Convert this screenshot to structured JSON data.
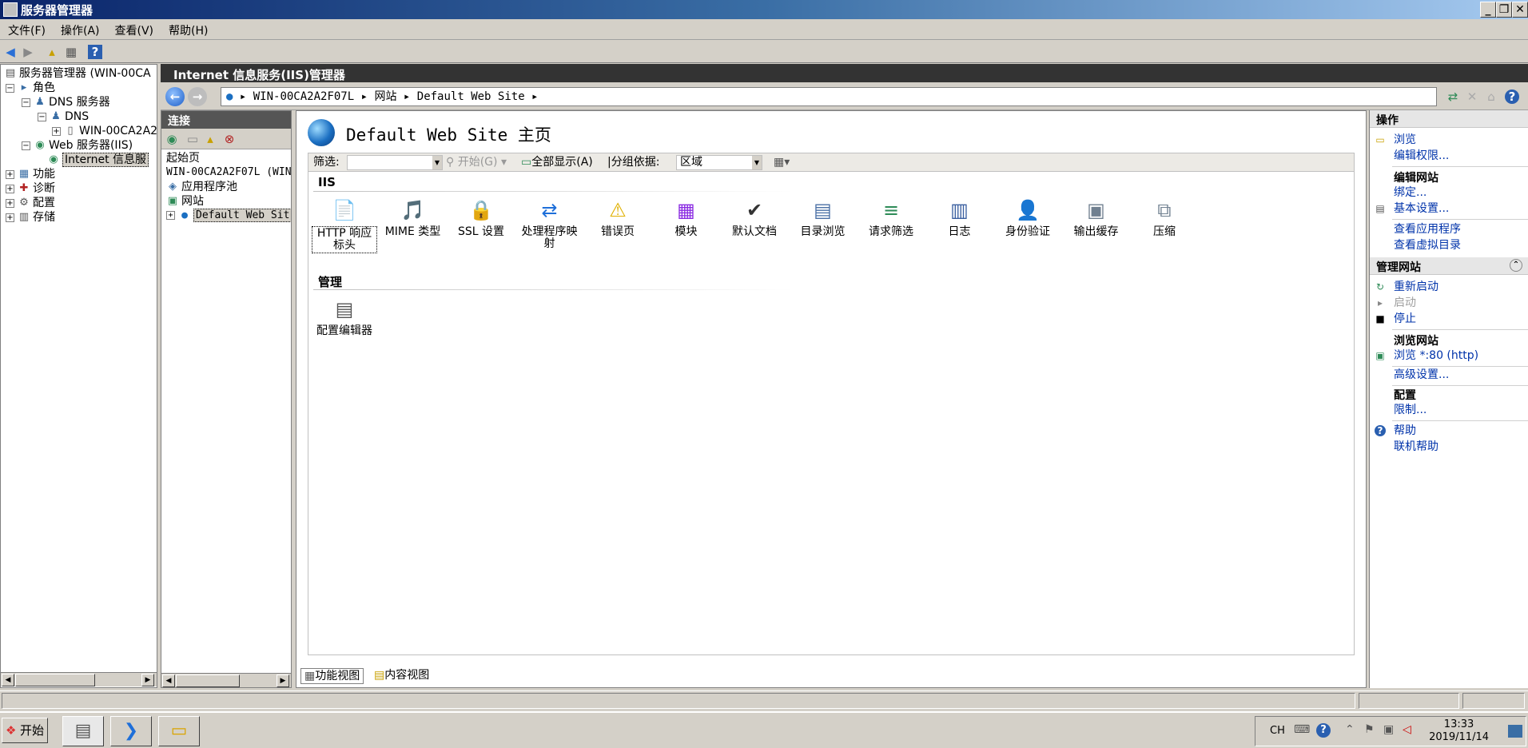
{
  "window": {
    "title": "服务器管理器",
    "min_symbol": "_",
    "restore_symbol": "❐",
    "close_symbol": "✕"
  },
  "menu": [
    "文件(F)",
    "操作(A)",
    "查看(V)",
    "帮助(H)"
  ],
  "tree": {
    "root": "服务器管理器 (WIN-00CA",
    "roles": "角色",
    "dns_server": "DNS 服务器",
    "dns": "DNS",
    "dns_host": "WIN-00CA2A2F",
    "web_server": "Web 服务器(IIS)",
    "iis": "Internet 信息服",
    "features": "功能",
    "diagnostics": "诊断",
    "config": "配置",
    "storage": "存储"
  },
  "iis_header": "Internet 信息服务(IIS)管理器",
  "breadcrumb": [
    "WIN-00CA2A2F07L",
    "网站",
    "Default Web Site"
  ],
  "connections": {
    "title": "连接",
    "start_page": "起始页",
    "server": "WIN-00CA2A2F07L (WIN",
    "app_pools": "应用程序池",
    "sites": "网站",
    "default_site": "Default Web Sit"
  },
  "main": {
    "title": "Default Web Site 主页",
    "filter_label": "筛选:",
    "go_label": "开始(G)",
    "show_all_label": "全部显示(A)",
    "group_by_label": "分组依据:",
    "group_by_value": "区域",
    "section_iis": "IIS",
    "section_manage": "管理",
    "features_iis": [
      {
        "name": "http-response-headers",
        "label": "HTTP 响应标头",
        "icon": "📄",
        "color": "#2e8b57"
      },
      {
        "name": "mime-types",
        "label": "MIME 类型",
        "icon": "🎵",
        "color": "#6a5acd"
      },
      {
        "name": "ssl-settings",
        "label": "SSL 设置",
        "icon": "🔒",
        "color": "#d4a017"
      },
      {
        "name": "handler-mappings",
        "label": "处理程序映射",
        "icon": "⇄",
        "color": "#1e6fd9"
      },
      {
        "name": "error-pages",
        "label": "错误页",
        "icon": "⚠",
        "color": "#e0b000"
      },
      {
        "name": "modules",
        "label": "模块",
        "icon": "▦",
        "color": "#8a2be2"
      },
      {
        "name": "default-document",
        "label": "默认文档",
        "icon": "✔",
        "color": "#333333"
      },
      {
        "name": "directory-browsing",
        "label": "目录浏览",
        "icon": "▤",
        "color": "#4a6fa5"
      },
      {
        "name": "request-filtering",
        "label": "请求筛选",
        "icon": "≡",
        "color": "#2e8b57"
      },
      {
        "name": "logging",
        "label": "日志",
        "icon": "▥",
        "color": "#3a5fa0"
      },
      {
        "name": "authentication",
        "label": "身份验证",
        "icon": "👤",
        "color": "#b8860b"
      },
      {
        "name": "output-caching",
        "label": "输出缓存",
        "icon": "▣",
        "color": "#708090"
      },
      {
        "name": "compression",
        "label": "压缩",
        "icon": "⧉",
        "color": "#708090"
      }
    ],
    "features_manage": [
      {
        "name": "configuration-editor",
        "label": "配置编辑器",
        "icon": "▤",
        "color": "#555555"
      }
    ]
  },
  "view_tabs": {
    "features": "功能视图",
    "content": "内容视图"
  },
  "actions": {
    "title": "操作",
    "browse": "浏览",
    "edit_permissions": "编辑权限...",
    "edit_site": "编辑网站",
    "bindings": "绑定...",
    "basic_settings": "基本设置...",
    "view_apps": "查看应用程序",
    "view_vdirs": "查看虚拟目录",
    "manage_site": "管理网站",
    "restart": "重新启动",
    "start": "启动",
    "stop": "停止",
    "browse_site": "浏览网站",
    "browse_80": "浏览 *:80 (http)",
    "advanced": "高级设置...",
    "configure": "配置",
    "limits": "限制...",
    "help": "帮助",
    "online_help": "联机帮助"
  },
  "taskbar": {
    "start": "开始",
    "lang": "CH",
    "time": "13:33",
    "date": "2019/11/14"
  }
}
